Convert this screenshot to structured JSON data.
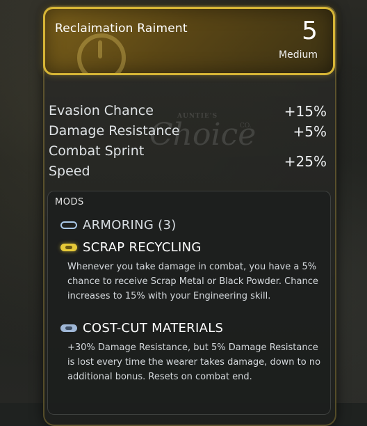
{
  "item": {
    "name": "Reclaimation Raiment",
    "value": "5",
    "weight_class": "Medium"
  },
  "stats": [
    {
      "label": "Evasion Chance",
      "value": "+15%"
    },
    {
      "label": "Damage Resistance",
      "value": "+5%"
    },
    {
      "label": "Combat Sprint Speed",
      "value": "+25%"
    }
  ],
  "watermark": {
    "top": "AUNTIE'S",
    "main": "Choice",
    "suffix": "CO."
  },
  "mods": {
    "title": "MODS",
    "items": [
      {
        "name": "ARMORING (3)",
        "icon": "empty-slot-icon",
        "description": ""
      },
      {
        "name": "SCRAP RECYCLING",
        "icon": "gold-mod-icon",
        "description": "Whenever you take damage in combat, you have a 5% chance to receive Scrap Metal or Black Powder. Chance increases to 15% with your Engineering skill."
      },
      {
        "name": "COST-CUT MATERIALS",
        "icon": "blue-mod-icon",
        "description": "+30% Damage Resistance, but 5% Damage Resistance is lost every time the wearer takes damage, down to no additional bonus. Resets on combat end."
      }
    ]
  },
  "colors": {
    "header_border": "#d6b536",
    "gold_mod": "#e6c938",
    "blue_mod": "#9fb7d6"
  }
}
